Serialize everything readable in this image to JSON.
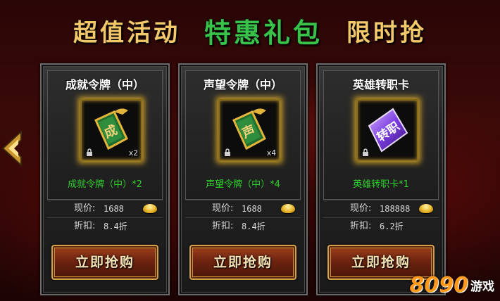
{
  "banner": {
    "part1": "超值活动",
    "part2": "特惠礼包",
    "part3": "限时抢"
  },
  "cards": [
    {
      "title": "成就令牌（中）",
      "icon": "achievement-token-icon",
      "quantity": "x2",
      "reward": "成就令牌（中）*2",
      "price_label": "现价:",
      "price": "1688",
      "discount_label": "折扣:",
      "discount": "8.4折",
      "buy_label": "立即抢购"
    },
    {
      "title": "声望令牌（中）",
      "icon": "prestige-token-icon",
      "quantity": "x4",
      "reward": "声望令牌（中）*4",
      "price_label": "现价:",
      "price": "1688",
      "discount_label": "折扣:",
      "discount": "8.4折",
      "buy_label": "立即抢购"
    },
    {
      "title": "英雄转职卡",
      "icon": "job-change-card-icon",
      "quantity": "",
      "reward": "英雄转职卡*1",
      "price_label": "现价:",
      "price": "188888",
      "discount_label": "折扣:",
      "discount": "6.2折",
      "buy_label": "立即抢购"
    }
  ],
  "currency_icon": "gold-ingot-icon",
  "watermark": {
    "number": "8090",
    "text": "游戏"
  },
  "colors": {
    "banner_gold": "#f3c86a",
    "banner_green": "#38c24a",
    "reward_green": "#2fd12c",
    "slot_glow": "#ffc428"
  }
}
